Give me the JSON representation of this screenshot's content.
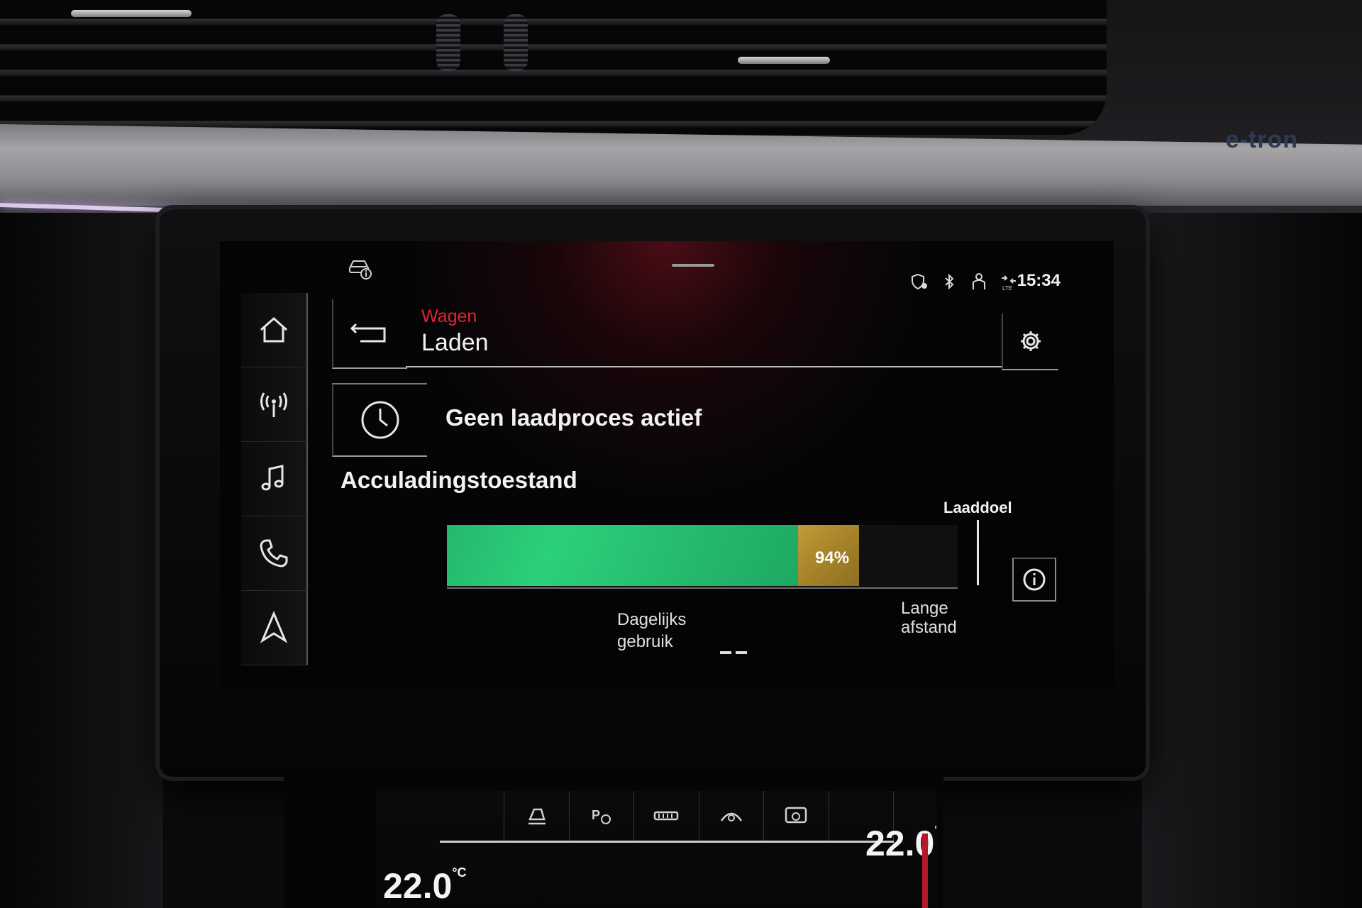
{
  "status_bar": {
    "time": "15:34",
    "icons": [
      "car-info-icon",
      "location-shield-icon",
      "bluetooth-icon",
      "person-icon",
      "lte-signal-icon"
    ]
  },
  "sidebar": {
    "items": [
      {
        "icon": "home-icon"
      },
      {
        "icon": "radio-icon"
      },
      {
        "icon": "music-icon"
      },
      {
        "icon": "phone-icon"
      },
      {
        "icon": "navigation-icon"
      }
    ]
  },
  "header": {
    "breadcrumb": "Wagen",
    "title": "Laden"
  },
  "timer": {
    "status_text": "Geen laadproces actief"
  },
  "battery": {
    "section_title": "Acculadingstoestand",
    "charge_target_label": "Laaddoel",
    "charge_percent_label": "94%",
    "charge_level": 0.94,
    "daily_segment_end": 0.8,
    "label_daily_line1": "Dagelijks",
    "label_daily_line2": "gebruik",
    "label_long_line1": "Lange",
    "label_long_line2": "afstand",
    "colors": {
      "daily": "#25b86d",
      "long_range": "#a9852b",
      "accent": "#e0262e"
    }
  },
  "climate": {
    "temp_left": "22.0",
    "temp_right": "22.0",
    "unit": "°C"
  }
}
